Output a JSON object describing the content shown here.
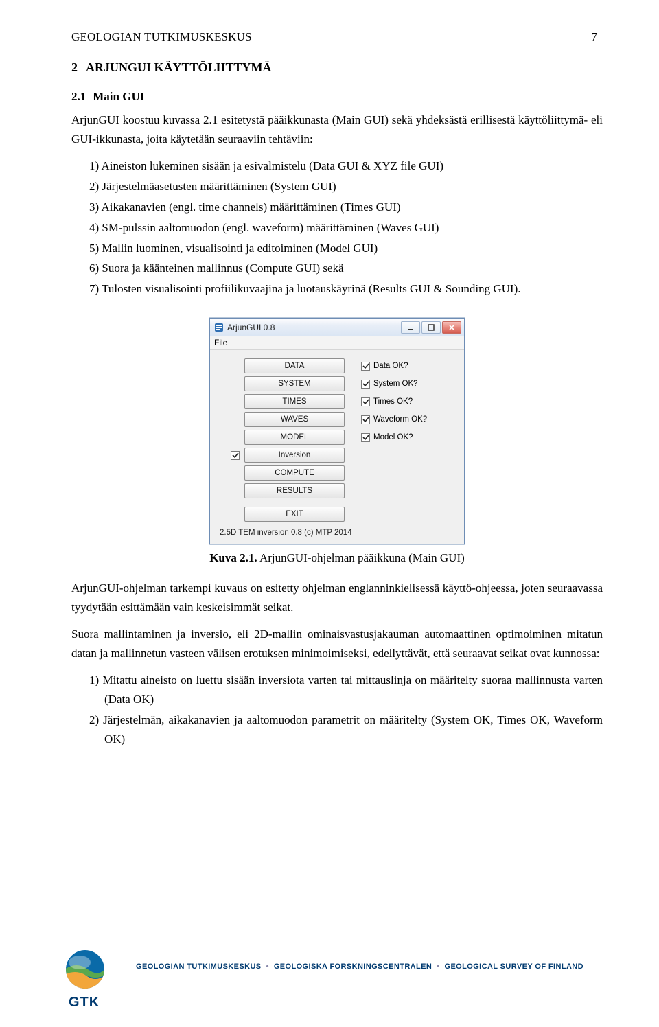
{
  "header": {
    "org": "GEOLOGIAN TUTKIMUSKESKUS",
    "page_num": "7"
  },
  "section": {
    "num": "2",
    "title": "ARJUNGUI KÄYTTÖLIITTYMÄ"
  },
  "subsection": {
    "num": "2.1",
    "title": "Main GUI"
  },
  "intro": "ArjunGUI koostuu kuvassa 2.1 esitetystä pääikkunasta (Main GUI) sekä yhdeksästä erillisestä käyttöliittymä- eli GUI-ikkunasta, joita käytetään seuraaviin tehtäviin:",
  "list1": [
    "1) Aineiston lukeminen sisään ja esivalmistelu (Data GUI & XYZ file GUI)",
    "2) Järjestelmäasetusten määrittäminen (System GUI)",
    "3) Aikakanavien (engl. time channels) määrittäminen (Times GUI)",
    "4) SM-pulssin aaltomuodon (engl. waveform) määrittäminen (Waves GUI)",
    "5) Mallin luominen, visualisointi ja editoiminen (Model GUI)",
    "6) Suora ja käänteinen mallinnus (Compute GUI) sekä",
    "7) Tulosten visualisointi profiilikuvaajina ja luotauskäyrinä (Results GUI & Sounding GUI)."
  ],
  "app": {
    "title": "ArjunGUI 0.8",
    "menu_file": "File",
    "buttons": {
      "data": "DATA",
      "system": "SYSTEM",
      "times": "TIMES",
      "waves": "WAVES",
      "model": "MODEL",
      "inversion": "Inversion",
      "compute": "COMPUTE",
      "results": "RESULTS",
      "exit": "EXIT"
    },
    "checks": {
      "data": "Data OK?",
      "system": "System OK?",
      "times": "Times OK?",
      "waveform": "Waveform OK?",
      "model": "Model OK?"
    },
    "status": "2.5D TEM inversion 0.8 (c) MTP 2014"
  },
  "caption": {
    "bold": "Kuva 2.1.",
    "rest": " ArjunGUI-ohjelman pääikkuna (Main GUI)"
  },
  "para2": "ArjunGUI-ohjelman tarkempi kuvaus on esitetty ohjelman englanninkielisessä käyttö-ohjeessa, joten seuraavassa tyydytään esittämään vain keskeisimmät seikat.",
  "para3": "Suora mallintaminen ja inversio, eli 2D-mallin ominaisvastusjakauman automaattinen optimoiminen mitatun datan ja mallinnetun vasteen välisen erotuksen minimoimiseksi, edellyttävät, että seuraavat seikat ovat kunnossa:",
  "list2": [
    "1) Mitattu aineisto on luettu sisään inversiota varten tai mittauslinja on määritelty suoraa mallinnusta varten (Data OK)",
    "2) Järjestelmän, aikakanavien ja aaltomuodon parametrit on määritelty (System OK, Times OK, Waveform OK)"
  ],
  "footer": {
    "fi": "GEOLOGIAN TUTKIMUSKESKUS",
    "sv": "GEOLOGISKA FORSKNINGSCENTRALEN",
    "en": "GEOLOGICAL SURVEY OF FINLAND",
    "logo": "GTK"
  }
}
